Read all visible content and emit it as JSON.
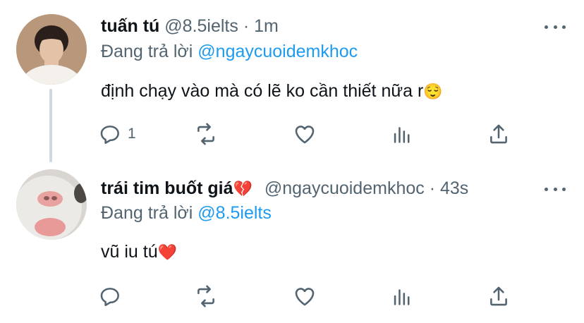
{
  "tweets": [
    {
      "name": "tuấn tú",
      "handle": "@8.5ielts",
      "separator": "·",
      "time": "1m",
      "reply_prefix": "Đang trả lời ",
      "reply_to": "@ngaycuoidemkhoc",
      "text": "định chạy vào mà có lẽ ko cần thiết nữa r",
      "text_emoji": "😌",
      "reply_count": "1",
      "avatar_icon": "person-photo-avatar"
    },
    {
      "name": "trái tim buốt giá",
      "name_emoji": "💔",
      "handle": "@ngaycuoidemkhoc",
      "separator": "·",
      "time": "43s",
      "reply_prefix": "Đang trả lời ",
      "reply_to": "@8.5ielts",
      "text": "vũ iu tú",
      "text_emoji": "❤️",
      "reply_count": "",
      "avatar_icon": "cat-photo-avatar"
    }
  ],
  "icons": {
    "reply": "reply-icon",
    "retweet": "retweet-icon",
    "like": "like-icon",
    "analytics": "analytics-icon",
    "share": "share-icon",
    "more": "more-icon"
  },
  "colors": {
    "accent": "#1d9bf0",
    "text": "#0f1419",
    "secondary": "#536471",
    "line": "#cfd9de"
  }
}
